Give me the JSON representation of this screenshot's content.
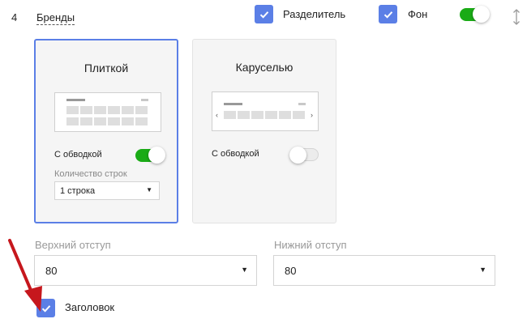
{
  "row": {
    "number": "4",
    "title": "Бренды",
    "separator_label": "Разделитель",
    "background_label": "Фон"
  },
  "layouts": [
    {
      "title": "Плиткой",
      "border_label": "С обводкой",
      "border_on": true,
      "rows_label": "Количество строк",
      "rows_value": "1 строка"
    },
    {
      "title": "Каруселью",
      "border_label": "С обводкой",
      "border_on": false
    }
  ],
  "padding": {
    "top_label": "Верхний отступ",
    "top_value": "80",
    "bottom_label": "Нижний отступ",
    "bottom_value": "80"
  },
  "header_checkbox_label": "Заголовок",
  "icons": {
    "dropdown": "caret-down-icon",
    "check": "check-icon",
    "reorder": "up-down-arrow-icon",
    "annotation": "red-arrow-icon"
  },
  "colors": {
    "accent": "#5b7fe6",
    "toggle_on": "#1aab16",
    "annotation": "#c6171d"
  }
}
